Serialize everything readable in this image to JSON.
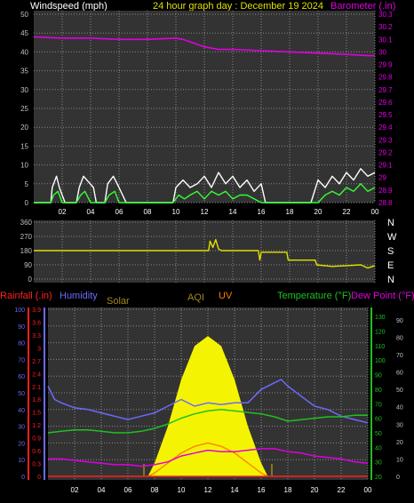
{
  "header": {
    "wind_label": "Windspeed (mph)",
    "title": "24 hour graph day : December 19 2024",
    "baro_label": "Barometer (.in)"
  },
  "colors": {
    "background": "#000000",
    "panel": "#333333",
    "grid": "#8a8a8a",
    "wind_gust": "#ffffff",
    "wind_avg": "#33ff33",
    "barometer": "#e000e0",
    "direction": "#e0e000",
    "rain": "#ff2020",
    "humidity": "#6a6aff",
    "solar": "#ffff00",
    "aqi": "#a08a20",
    "uv": "#ff8000",
    "temperature": "#20c020",
    "dewpoint": "#e000e0",
    "hour_labels": "#ffffff",
    "tick_labels": "#c0c0c0"
  },
  "chart_data": [
    {
      "type": "line",
      "title": "24 hour graph day : December 19 2024",
      "x_ticks": [
        "02",
        "04",
        "06",
        "08",
        "10",
        "12",
        "14",
        "16",
        "18",
        "20",
        "22",
        "00"
      ],
      "y_left": {
        "label": "Windspeed (mph)",
        "ticks": [
          0,
          5,
          10,
          15,
          20,
          25,
          30,
          35,
          40,
          45,
          50
        ],
        "range": [
          0,
          50
        ]
      },
      "y_right": {
        "label": "Barometer (.in)",
        "ticks": [
          "28.8",
          "28.9",
          "29",
          "29.1",
          "29.2",
          "29.3",
          "29.4",
          "29.5",
          "29.6",
          "29.7",
          "29.8",
          "29.9",
          "30",
          "30.1",
          "30.2",
          "30.3"
        ],
        "range": [
          28.8,
          30.3
        ]
      },
      "series": [
        {
          "name": "Barometer",
          "axis": "right",
          "x": [
            0,
            2,
            4,
            6,
            8,
            10,
            10.5,
            11,
            11.5,
            12,
            12.5,
            13,
            14,
            16,
            18,
            20,
            22,
            23.5,
            24
          ],
          "values": [
            30.12,
            30.11,
            30.11,
            30.1,
            30.1,
            30.11,
            30.1,
            30.08,
            30.06,
            30.04,
            30.03,
            30.02,
            30.02,
            30.01,
            30.0,
            29.99,
            29.98,
            29.97,
            29.97
          ]
        },
        {
          "name": "Gust",
          "axis": "left",
          "x": [
            0,
            1.2,
            1.3,
            1.6,
            1.8,
            2.2,
            2.4,
            3,
            3.2,
            3.5,
            4.2,
            4.4,
            5,
            5.2,
            5.6,
            6,
            6.5,
            7,
            8,
            9,
            9.8,
            10,
            10.5,
            11,
            11.5,
            12,
            12.5,
            13,
            13.5,
            14,
            14.5,
            15,
            15.5,
            16,
            16.3,
            16.5,
            17,
            17.5,
            18,
            18.5,
            19,
            19.5,
            20,
            20.5,
            21,
            21.5,
            22,
            22.5,
            23,
            23.5,
            24
          ],
          "values": [
            0,
            0,
            4,
            7,
            4,
            0,
            0,
            0,
            4,
            7,
            4,
            0,
            0,
            5,
            7,
            4,
            0,
            0,
            0,
            0,
            0,
            4,
            6,
            4,
            5,
            7,
            4,
            8,
            5,
            7,
            4,
            6,
            3,
            5,
            0,
            0,
            0,
            0,
            0,
            0,
            0,
            0,
            6,
            4,
            7,
            5,
            8,
            6,
            9,
            7,
            8
          ]
        },
        {
          "name": "Average",
          "axis": "left",
          "x": [
            0,
            1.2,
            1.4,
            1.7,
            2,
            3,
            3.3,
            3.6,
            4,
            5,
            5.3,
            5.7,
            6,
            9.8,
            10.2,
            10.6,
            11,
            11.5,
            12,
            12.5,
            13,
            13.5,
            14,
            14.5,
            15,
            15.5,
            16,
            16.5,
            20,
            20.5,
            21,
            21.5,
            22,
            22.5,
            23,
            23.5,
            24
          ],
          "values": [
            0,
            0,
            2,
            3,
            0,
            0,
            2,
            3,
            0,
            0,
            2,
            3,
            0,
            0,
            2,
            1,
            2,
            3,
            1,
            3,
            2,
            3,
            1,
            2,
            2,
            1,
            0,
            0,
            0,
            2,
            3,
            2,
            4,
            3,
            5,
            3,
            4
          ]
        }
      ]
    },
    {
      "type": "line",
      "title": "",
      "y_left": {
        "ticks": [
          0,
          90,
          180,
          270,
          360
        ],
        "range": [
          0,
          360
        ]
      },
      "y_right": {
        "ticks": [
          "N",
          "W",
          "S",
          "E",
          "N"
        ]
      },
      "series": [
        {
          "name": "Wind direction",
          "x": [
            0,
            12.3,
            12.4,
            12.6,
            12.8,
            13,
            13.2,
            14,
            15.8,
            15.9,
            16,
            17.8,
            17.9,
            19.8,
            19.9,
            21,
            22,
            23,
            23.5,
            24
          ],
          "values": [
            180,
            180,
            240,
            200,
            250,
            190,
            180,
            180,
            180,
            120,
            170,
            170,
            120,
            120,
            90,
            80,
            85,
            90,
            70,
            85
          ]
        }
      ]
    },
    {
      "type": "line",
      "title": "",
      "legend": [
        "Rainfall (.in)",
        "Humidity",
        "Solar",
        "AQI",
        "UV",
        "Temperature (°F)",
        "Dew Point (°F)"
      ],
      "y_rain": {
        "label": "Rainfall (.in)",
        "ticks": [
          "0",
          "0.3",
          "0.6",
          "0.9",
          "1.2",
          "1.5",
          "1.8",
          "2.1",
          "2.4",
          "2.7",
          "3",
          "3.3",
          "3.6",
          "3.9"
        ],
        "range": [
          0,
          3.9
        ]
      },
      "y_humidity": {
        "label": "Humidity",
        "ticks": [
          0,
          10,
          20,
          30,
          40,
          50,
          60,
          70,
          80,
          90,
          100
        ],
        "range": [
          0,
          100
        ]
      },
      "y_temp": {
        "label": "Temperature (°F)",
        "ticks": [
          20,
          30,
          40,
          50,
          60,
          70,
          80,
          90,
          100,
          110,
          120,
          130
        ],
        "range": [
          20,
          135
        ]
      },
      "y_uv": {
        "ticks": [
          0,
          10,
          20,
          30,
          40,
          50,
          60,
          70,
          80,
          90
        ],
        "range": [
          0,
          96
        ]
      },
      "series": [
        {
          "name": "Humidity",
          "x": [
            0,
            0.5,
            1,
            2,
            3,
            4,
            5,
            6,
            7,
            8,
            9,
            10,
            11,
            12,
            13,
            14,
            15,
            16,
            17,
            17.5,
            18,
            19,
            20,
            21,
            22,
            23,
            24
          ],
          "values": [
            54,
            46,
            44,
            41,
            40,
            38,
            36,
            34,
            36,
            38,
            42,
            46,
            42,
            44,
            43,
            44,
            44,
            52,
            56,
            58,
            54,
            48,
            42,
            40,
            36,
            34,
            32
          ]
        },
        {
          "name": "Temperature",
          "x": [
            0,
            1,
            2,
            3,
            4,
            5,
            6,
            7,
            8,
            9,
            10,
            11,
            12,
            13,
            14,
            15,
            16,
            17,
            18,
            19,
            20,
            21,
            22,
            23,
            24
          ],
          "values": [
            50,
            51,
            52,
            52,
            51,
            50,
            50,
            51,
            53,
            56,
            60,
            63,
            65,
            66,
            65,
            64,
            63,
            61,
            58,
            59,
            60,
            61,
            61,
            62,
            62
          ]
        },
        {
          "name": "Dew Point",
          "x": [
            0,
            1,
            2,
            3,
            4,
            5,
            6,
            7,
            8,
            9,
            10,
            11,
            12,
            13,
            14,
            15,
            16,
            17,
            18,
            19,
            20,
            21,
            22,
            23,
            24
          ],
          "values": [
            32,
            32,
            31,
            30,
            29,
            28,
            28,
            27,
            28,
            30,
            34,
            36,
            38,
            37,
            37,
            38,
            39,
            39,
            37,
            36,
            34,
            33,
            32,
            30,
            29
          ]
        },
        {
          "name": "Solar",
          "x": [
            7.5,
            8,
            9,
            10,
            11,
            12,
            13,
            14,
            15,
            16,
            16.5
          ],
          "values": [
            0,
            8,
            30,
            58,
            78,
            84,
            78,
            58,
            30,
            8,
            0
          ]
        },
        {
          "name": "UV",
          "x": [
            7.5,
            8,
            9,
            10,
            11,
            12,
            13,
            14,
            15,
            16,
            16.5
          ],
          "values": [
            0,
            2,
            8,
            14,
            18,
            20,
            18,
            14,
            8,
            2,
            0
          ]
        },
        {
          "name": "Rainfall",
          "x": [
            0,
            24
          ],
          "values": [
            0,
            0
          ]
        }
      ]
    }
  ]
}
